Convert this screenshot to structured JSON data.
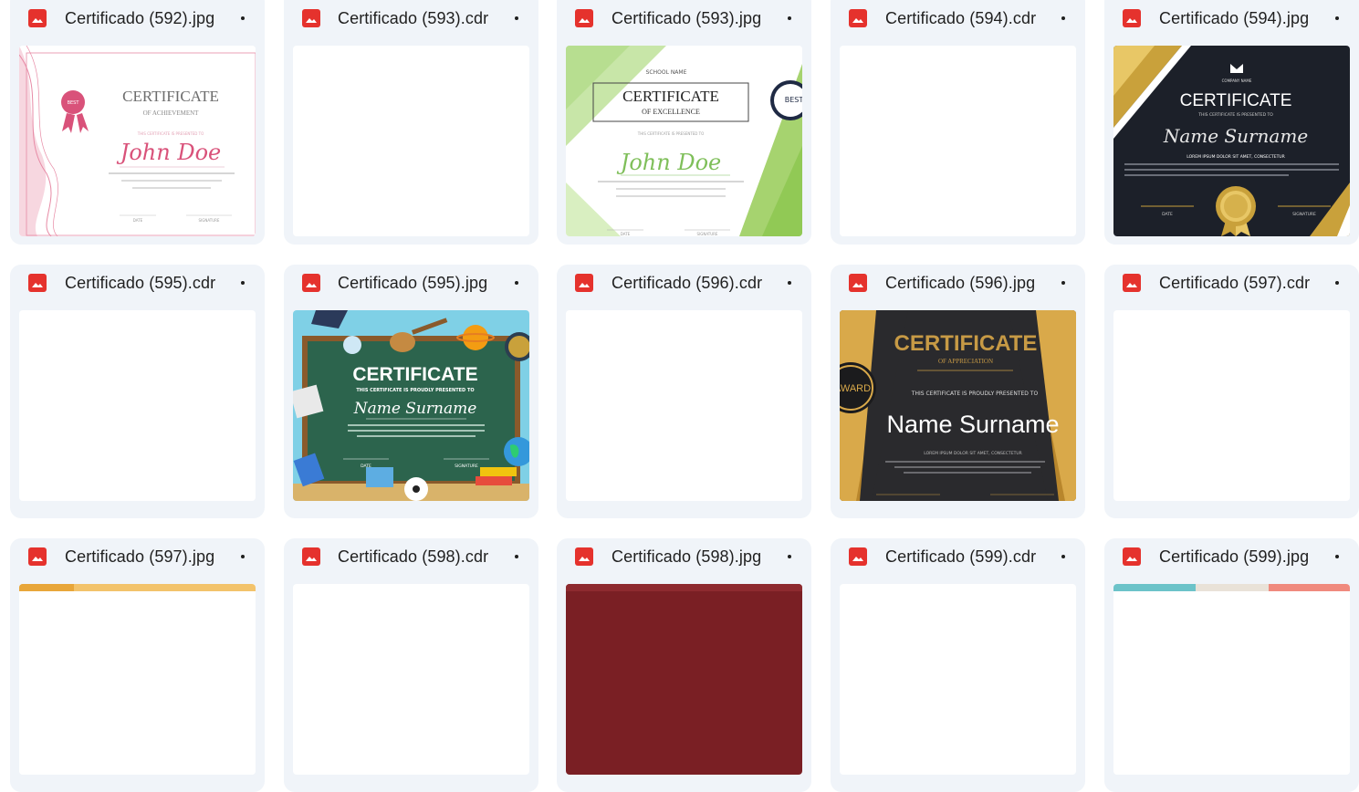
{
  "files": [
    {
      "name": "Certificado (592).jpg",
      "thumbnail": "certificate-pink-achievement"
    },
    {
      "name": "Certificado (593).cdr",
      "thumbnail": "blank"
    },
    {
      "name": "Certificado (593).jpg",
      "thumbnail": "certificate-green-excellence"
    },
    {
      "name": "Certificado (594).cdr",
      "thumbnail": "blank"
    },
    {
      "name": "Certificado (594).jpg",
      "thumbnail": "certificate-dark-gold"
    },
    {
      "name": "Certificado (595).cdr",
      "thumbnail": "blank"
    },
    {
      "name": "Certificado (595).jpg",
      "thumbnail": "certificate-school-chalkboard"
    },
    {
      "name": "Certificado (596).cdr",
      "thumbnail": "blank"
    },
    {
      "name": "Certificado (596).jpg",
      "thumbnail": "certificate-appreciation-gold"
    },
    {
      "name": "Certificado (597).cdr",
      "thumbnail": "blank"
    },
    {
      "name": "Certificado (597).jpg",
      "thumbnail": "partial"
    },
    {
      "name": "Certificado (598).cdr",
      "thumbnail": "blank"
    },
    {
      "name": "Certificado (598).jpg",
      "thumbnail": "partial"
    },
    {
      "name": "Certificado (599).cdr",
      "thumbnail": "blank"
    },
    {
      "name": "Certificado (599).jpg",
      "thumbnail": "partial"
    }
  ],
  "thumb_text": {
    "pink": {
      "title": "CERTIFICATE",
      "subtitle": "OF ACHIEVEMENT",
      "badge": "BEST",
      "presented": "THIS CERTIFICATE IS PRESENTED TO",
      "name": "John Doe",
      "date": "DATE",
      "signature": "SIGNATURE"
    },
    "green": {
      "school": "SCHOOL NAME",
      "title": "CERTIFICATE",
      "subtitle": "OF EXCELLENCE",
      "badge": "BEST",
      "presented": "THIS CERTIFICATE IS PRESENTED TO",
      "name": "John Doe",
      "date": "DATE",
      "signature": "SIGNATURE"
    },
    "dark": {
      "company": "COMPANY NAME",
      "title": "CERTIFICATE",
      "presented": "THIS CERTIFICATE IS PRESENTED TO",
      "name": "Name Surname",
      "lorem": "LOREM IPSUM DOLOR SIT AMET, CONSECTETUR",
      "date": "DATE",
      "signature": "SIGNATURE"
    },
    "school": {
      "title": "CERTIFICATE",
      "presented": "THIS CERTIFICATE IS PROUDLY PRESENTED TO",
      "name": "Name Surname",
      "date": "DATE",
      "signature": "SIGNATURE"
    },
    "appreciation": {
      "title": "CERTIFICATE",
      "subtitle": "OF APPRECIATION",
      "award": "AWARD",
      "presented": "THIS CERTIFICATE IS PROUDLY PRESENTED TO",
      "name": "Name Surname",
      "lorem": "LOREM IPSUM DOLOR SIT AMET, CONSECTETUR"
    }
  },
  "colors": {
    "card_bg": "#f0f4f9",
    "image_icon": "#e5322d",
    "text": "#1f1f1f"
  }
}
